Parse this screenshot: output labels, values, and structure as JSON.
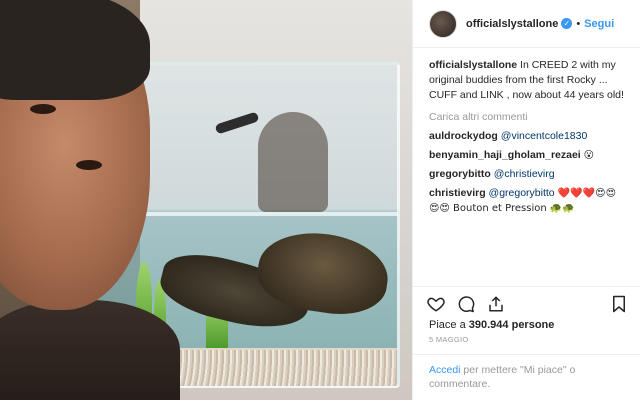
{
  "header": {
    "username": "officialslystallone",
    "separator": "•",
    "follow_label": "Segui"
  },
  "caption": {
    "username": "officialslystallone",
    "text": "In CREED 2 with my original buddies from the first Rocky ... CUFF and LINK , now about 44 years old!"
  },
  "load_more": "Carica altri commenti",
  "comments": [
    {
      "username": "auldrockydog",
      "mention": "@vincentcole1830",
      "text": ""
    },
    {
      "username": "benyamin_haji_gholam_rezaei",
      "mention": "",
      "text": "😮"
    },
    {
      "username": "gregorybitto",
      "mention": "@christievirg",
      "text": ""
    },
    {
      "username": "christievirg",
      "mention": "@gregorybitto",
      "text": " ❤️❤️❤️😍😍😍😍 Bouton et Pression 🐢🐢"
    }
  ],
  "likes": {
    "prefix": "Piace a",
    "count": "390.944",
    "suffix": "persone"
  },
  "date": "5 maggio",
  "login": {
    "link": "Accedi",
    "text": " per mettere \"Mi piace\" o commentare."
  },
  "icons": [
    "heart-icon",
    "comment-icon",
    "share-icon",
    "bookmark-icon",
    "verified-icon"
  ],
  "colors": {
    "accent": "#3897f0",
    "text": "#262626",
    "muted": "#999999",
    "mention": "#003569"
  }
}
